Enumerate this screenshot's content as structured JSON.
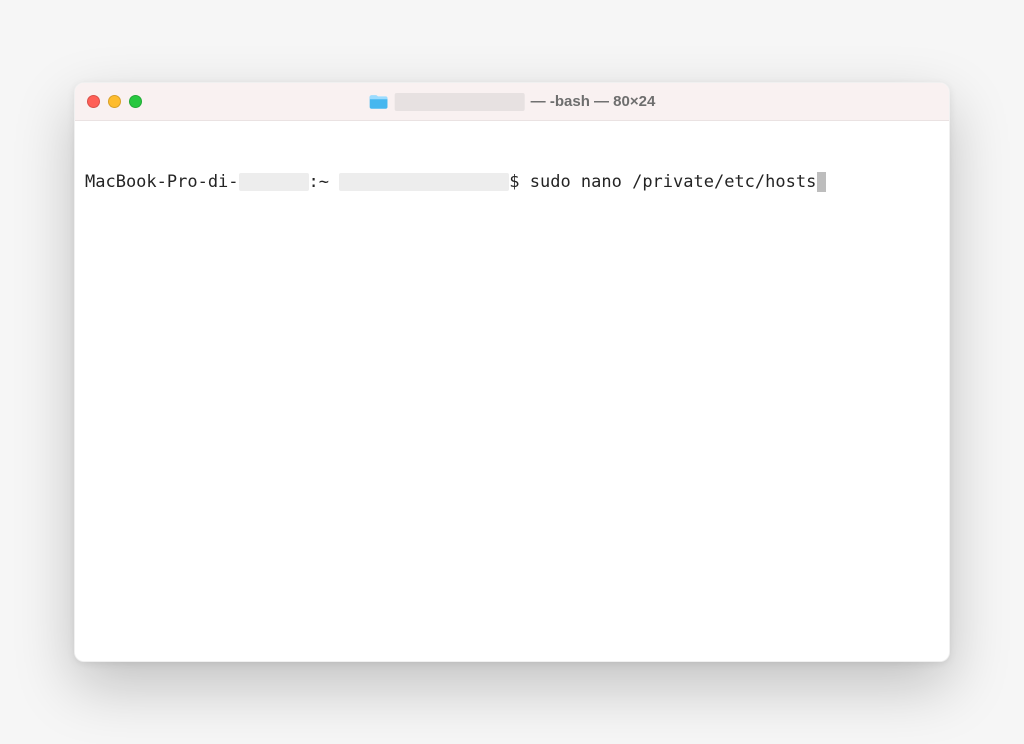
{
  "window": {
    "title_suffix": "— -bash — 80×24",
    "icon": "folder-icon",
    "traffic": {
      "close": "#ff5f57",
      "minimize": "#febc2e",
      "zoom": "#28c840"
    }
  },
  "terminal": {
    "prompt_host_prefix": "MacBook-Pro-di-",
    "prompt_sep": ":~ ",
    "prompt_end": "$ ",
    "command": "sudo nano /private/etc/hosts"
  }
}
